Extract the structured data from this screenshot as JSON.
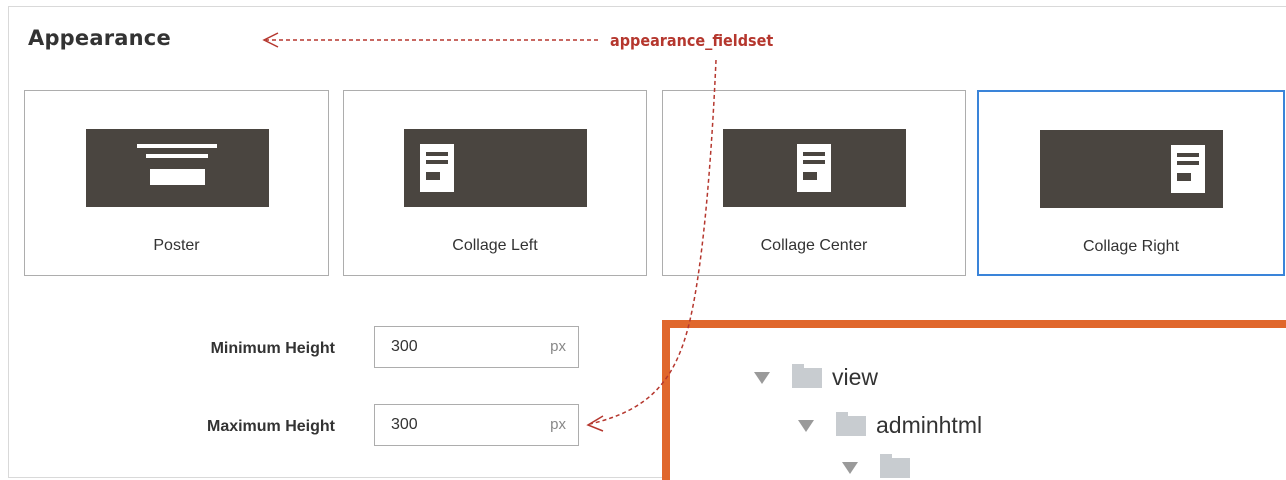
{
  "section": {
    "title": "Appearance"
  },
  "annotation": {
    "text": "appearance_fieldset"
  },
  "appearance_options": [
    {
      "label": "Poster",
      "icon": "poster-layout-icon",
      "selected": false
    },
    {
      "label": "Collage Left",
      "icon": "collage-left-layout-icon",
      "selected": false
    },
    {
      "label": "Collage Center",
      "icon": "collage-center-layout-icon",
      "selected": false
    },
    {
      "label": "Collage Right",
      "icon": "collage-right-layout-icon",
      "selected": true
    }
  ],
  "fields": {
    "min_height": {
      "label": "Minimum Height",
      "value": "300",
      "unit": "px"
    },
    "max_height": {
      "label": "Maximum Height",
      "value": "300",
      "unit": "px"
    }
  },
  "file_tree": [
    {
      "name": "view",
      "icon": "folder-icon",
      "expanded": true
    },
    {
      "name": "adminhtml",
      "icon": "folder-icon",
      "expanded": true
    }
  ],
  "colors": {
    "annotation": "#b5372e",
    "selected_border": "#3a84d9",
    "thumb_fill": "#4a4540",
    "tree_border": "#e0672c"
  }
}
